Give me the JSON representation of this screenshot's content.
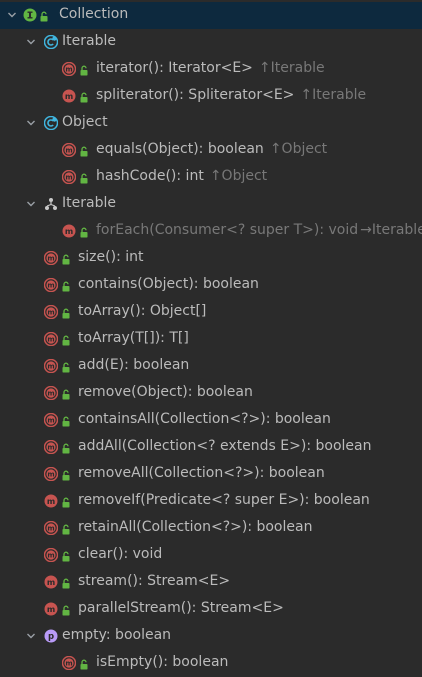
{
  "root": {
    "label": "Collection",
    "icon": "interface-icon"
  },
  "groups": [
    {
      "id": "iterable-1",
      "label": "Iterable",
      "icon": "abstract-class-icon",
      "items": [
        {
          "name": "iterator",
          "sig": "(): Iterator<E>",
          "origin": "↑Iterable",
          "icon": "abstract-method-icon"
        },
        {
          "name": "spliterator",
          "sig": "(): Spliterator<E>",
          "origin": "↑Iterable",
          "icon": "method-icon"
        }
      ]
    },
    {
      "id": "object",
      "label": "Object",
      "icon": "abstract-class-icon",
      "items": [
        {
          "name": "equals",
          "sig": "(Object): boolean",
          "origin": "↑Object",
          "icon": "abstract-method-icon"
        },
        {
          "name": "hashCode",
          "sig": "(): int",
          "origin": "↑Object",
          "icon": "abstract-method-icon"
        }
      ]
    },
    {
      "id": "iterable-2",
      "label": "Iterable",
      "icon": "inheritance-icon",
      "items": [
        {
          "name": "forEach",
          "sig": "(Consumer<? super T>): void",
          "origin": "→Iterable",
          "icon": "method-icon",
          "inherited": true
        }
      ]
    }
  ],
  "methods": [
    {
      "name": "size",
      "sig": "(): int",
      "icon": "abstract-method-icon"
    },
    {
      "name": "contains",
      "sig": "(Object): boolean",
      "icon": "abstract-method-icon"
    },
    {
      "name": "toArray",
      "sig": "(): Object[]",
      "icon": "abstract-method-icon"
    },
    {
      "name": "toArray",
      "sig": "(T[]): T[]",
      "icon": "abstract-method-icon"
    },
    {
      "name": "add",
      "sig": "(E): boolean",
      "icon": "abstract-method-icon"
    },
    {
      "name": "remove",
      "sig": "(Object): boolean",
      "icon": "abstract-method-icon"
    },
    {
      "name": "containsAll",
      "sig": "(Collection<?>): boolean",
      "icon": "abstract-method-icon"
    },
    {
      "name": "addAll",
      "sig": "(Collection<? extends E>): boolean",
      "icon": "abstract-method-icon"
    },
    {
      "name": "removeAll",
      "sig": "(Collection<?>): boolean",
      "icon": "abstract-method-icon"
    },
    {
      "name": "removeIf",
      "sig": "(Predicate<? super E>): boolean",
      "icon": "method-icon"
    },
    {
      "name": "retainAll",
      "sig": "(Collection<?>): boolean",
      "icon": "abstract-method-icon"
    },
    {
      "name": "clear",
      "sig": "(): void",
      "icon": "abstract-method-icon"
    },
    {
      "name": "stream",
      "sig": "(): Stream<E>",
      "icon": "method-icon"
    },
    {
      "name": "parallelStream",
      "sig": "(): Stream<E>",
      "icon": "method-icon"
    }
  ],
  "property": {
    "label": "empty: boolean",
    "icon": "property-icon",
    "items": [
      {
        "name": "isEmpty",
        "sig": "(): boolean",
        "icon": "abstract-method-icon"
      }
    ]
  },
  "colors": {
    "background": "#2b2b2b",
    "selected_row": "#0d293e",
    "text": "#bbbbbb",
    "dim_text": "#787878",
    "method_red": "#c75450",
    "interface_green": "#62b543",
    "class_blue": "#40b6e0",
    "property_purple": "#b99bf8",
    "lock_green": "#62b543",
    "arrow": "#9aa0a6"
  }
}
